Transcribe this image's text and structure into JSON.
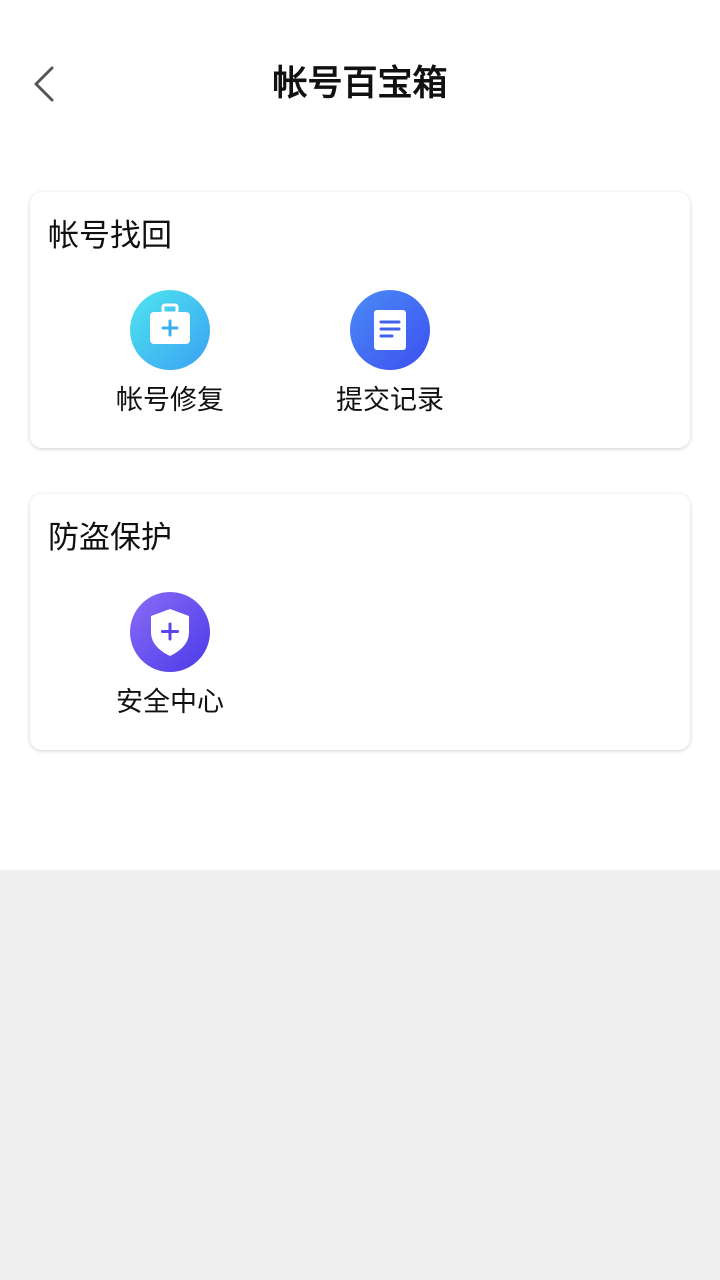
{
  "header": {
    "title": "帐号百宝箱",
    "back_icon": "chevron-left-icon"
  },
  "sections": [
    {
      "title": "帐号找回",
      "items": [
        {
          "label": "帐号修复",
          "icon": "first-aid-kit-icon",
          "color": "#3ab8f3"
        },
        {
          "label": "提交记录",
          "icon": "document-icon",
          "color": "#3f66f2"
        }
      ]
    },
    {
      "title": "防盗保护",
      "items": [
        {
          "label": "安全中心",
          "icon": "shield-plus-icon",
          "color": "#6a50ef"
        }
      ]
    }
  ],
  "colors": {
    "background": "#ffffff",
    "footer_background": "#efefef",
    "text": "#111111"
  }
}
